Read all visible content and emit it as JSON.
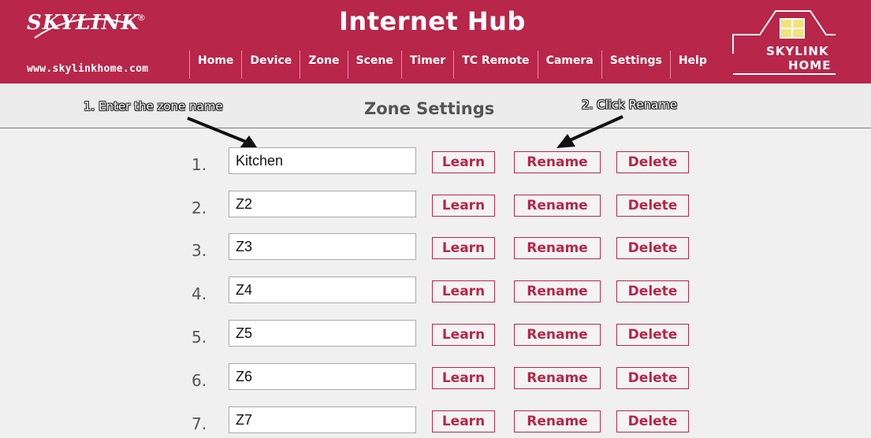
{
  "brand": {
    "logo_text": "SKYLINK",
    "reg_mark": "®",
    "url": "www.skylinkhome.com",
    "house_line1": "SKYLINK",
    "house_line2": "HOME",
    "color_primary": "#b8264a"
  },
  "header": {
    "title": "Internet Hub"
  },
  "nav": [
    "Home",
    "Device",
    "Zone",
    "Scene",
    "Timer",
    "TC Remote",
    "Camera",
    "Settings",
    "Help"
  ],
  "page": {
    "title": "Zone Settings"
  },
  "annotations": {
    "step1": "1. Enter the zone name",
    "step2": "2. Click Rename"
  },
  "zones": [
    {
      "num": "1.",
      "value": "Kitchen"
    },
    {
      "num": "2.",
      "value": "Z2"
    },
    {
      "num": "3.",
      "value": "Z3"
    },
    {
      "num": "4.",
      "value": "Z4"
    },
    {
      "num": "5.",
      "value": "Z5"
    },
    {
      "num": "6.",
      "value": "Z6"
    },
    {
      "num": "7.",
      "value": "Z7"
    }
  ],
  "buttons": {
    "learn": "Learn",
    "rename": "Rename",
    "delete": "Delete"
  }
}
